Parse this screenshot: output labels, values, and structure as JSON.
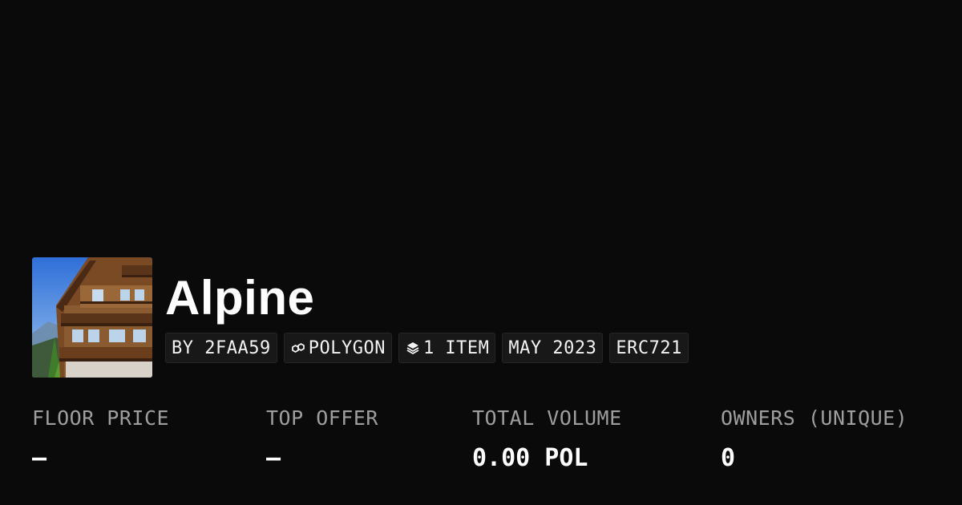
{
  "collection": {
    "name": "Alpine",
    "image_alt": "Alpine chalet collection image"
  },
  "chips": {
    "creator": "BY 2FAA59",
    "chain": "POLYGON",
    "items": "1 ITEM",
    "created": "MAY 2023",
    "standard": "ERC721"
  },
  "icons": {
    "chain": "polygon-icon",
    "items": "layers-icon"
  },
  "stats": {
    "floor_price": {
      "label": "FLOOR PRICE",
      "value": "–"
    },
    "top_offer": {
      "label": "TOP OFFER",
      "value": "–"
    },
    "total_volume": {
      "label": "TOTAL VOLUME",
      "value": "0.00 POL"
    },
    "owners": {
      "label": "OWNERS (UNIQUE)",
      "value": "0"
    }
  },
  "colors": {
    "background": "#0a0a0a",
    "chip_background": "#181818",
    "label_gray": "#9e9e9e"
  }
}
